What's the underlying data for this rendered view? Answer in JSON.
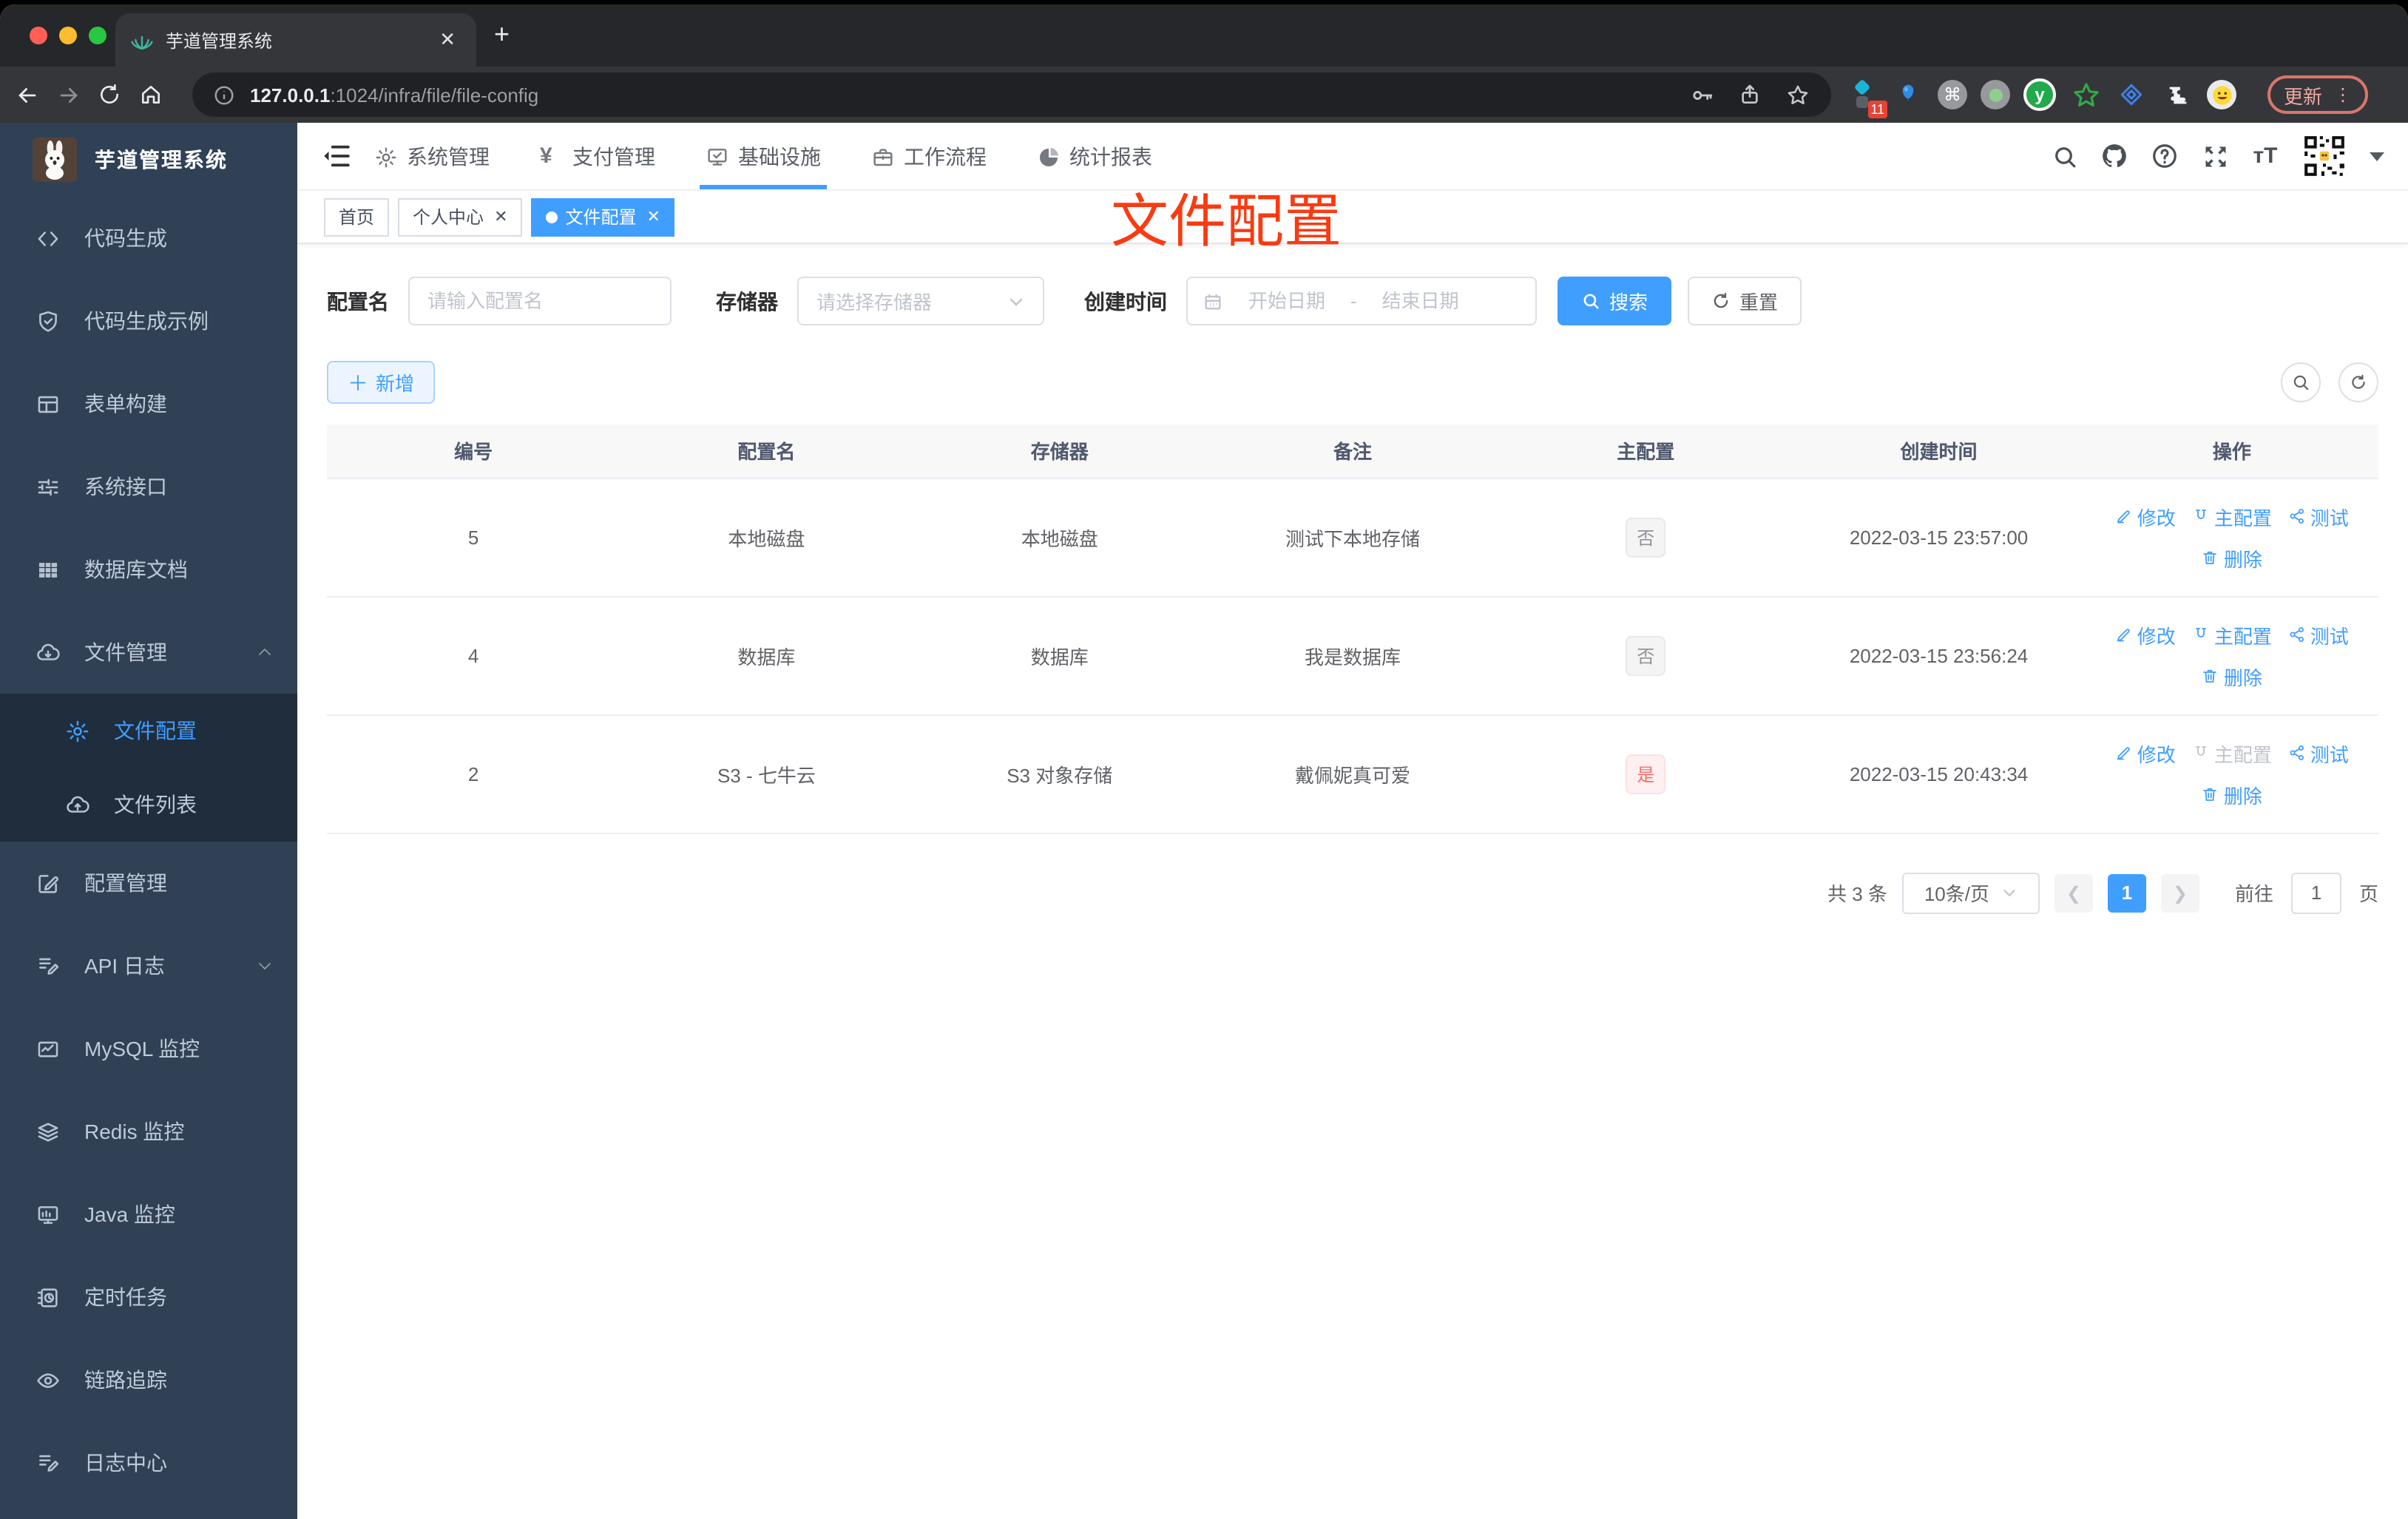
{
  "browser": {
    "tab_title": "芋道管理系统",
    "url_host": "127.0.0.1",
    "url_rest": ":1024/infra/file/file-config",
    "extension_badge": "11",
    "update_label": "更新"
  },
  "annotation": {
    "text": "文件配置",
    "color": "#f93b12"
  },
  "sidebar": {
    "app_title": "芋道管理系统",
    "items": [
      {
        "label": "代码生成",
        "icon": "code-icon"
      },
      {
        "label": "代码生成示例",
        "icon": "shield-check-icon"
      },
      {
        "label": "表单构建",
        "icon": "form-grid-icon"
      },
      {
        "label": "系统接口",
        "icon": "sliders-icon"
      },
      {
        "label": "数据库文档",
        "icon": "table-grid-icon"
      },
      {
        "label": "文件管理",
        "icon": "cloud-download-icon",
        "expanded": true,
        "children": [
          {
            "label": "文件配置",
            "icon": "gear-icon",
            "active": true
          },
          {
            "label": "文件列表",
            "icon": "cloud-upload-icon",
            "active": false
          }
        ]
      },
      {
        "label": "配置管理",
        "icon": "edit-square-icon"
      },
      {
        "label": "API 日志",
        "icon": "doc-edit-icon",
        "collapsed": true
      },
      {
        "label": "MySQL 监控",
        "icon": "chart-monitor-icon"
      },
      {
        "label": "Redis 监控",
        "icon": "layers-icon"
      },
      {
        "label": "Java 监控",
        "icon": "monitor-icon"
      },
      {
        "label": "定时任务",
        "icon": "schedule-icon"
      },
      {
        "label": "链路追踪",
        "icon": "eye-icon"
      },
      {
        "label": "日志中心",
        "icon": "log-edit-icon"
      }
    ]
  },
  "topnav": {
    "items": [
      {
        "label": "系统管理",
        "icon": "gear-icon",
        "active": false
      },
      {
        "label": "支付管理",
        "icon": "yen-icon",
        "active": false
      },
      {
        "label": "基础设施",
        "icon": "infra-monitor-icon",
        "active": true
      },
      {
        "label": "工作流程",
        "icon": "briefcase-icon",
        "active": false
      },
      {
        "label": "统计报表",
        "icon": "chart-pie-icon",
        "active": false
      }
    ]
  },
  "tags": [
    {
      "label": "首页",
      "closable": false,
      "active": false
    },
    {
      "label": "个人中心",
      "closable": true,
      "active": false
    },
    {
      "label": "文件配置",
      "closable": true,
      "active": true
    }
  ],
  "filters": {
    "name_label": "配置名",
    "name_placeholder": "请输入配置名",
    "storage_label": "存储器",
    "storage_placeholder": "请选择存储器",
    "date_label": "创建时间",
    "date_start_placeholder": "开始日期",
    "date_separator": "-",
    "date_end_placeholder": "结束日期",
    "search_label": "搜索",
    "reset_label": "重置"
  },
  "toolbar": {
    "add_label": "新增"
  },
  "table": {
    "columns": [
      "编号",
      "配置名",
      "存储器",
      "备注",
      "主配置",
      "创建时间",
      "操作"
    ],
    "action_labels": {
      "modify": "修改",
      "primary": "主配置",
      "test": "测试",
      "delete": "删除"
    },
    "rows": [
      {
        "id": "5",
        "name": "本地磁盘",
        "storage": "本地磁盘",
        "remark": "测试下本地存储",
        "primary": "否",
        "primary_state": "no",
        "created": "2022-03-15 23:57:00",
        "primary_action_disabled": false
      },
      {
        "id": "4",
        "name": "数据库",
        "storage": "数据库",
        "remark": "我是数据库",
        "primary": "否",
        "primary_state": "no",
        "created": "2022-03-15 23:56:24",
        "primary_action_disabled": false
      },
      {
        "id": "2",
        "name": "S3 - 七牛云",
        "storage": "S3 对象存储",
        "remark": "戴佩妮真可爱",
        "primary": "是",
        "primary_state": "yes",
        "created": "2022-03-15 20:43:34",
        "primary_action_disabled": true
      }
    ]
  },
  "pagination": {
    "total_label": "共 3 条",
    "page_size_label": "10条/页",
    "current_page": "1",
    "goto_label": "前往",
    "goto_value": "1",
    "page_unit": "页"
  },
  "colors": {
    "accent": "#409eff",
    "annotation_red": "#f93b12",
    "sidebar_bg": "#304156",
    "submenu_bg": "#1f2d3d"
  }
}
